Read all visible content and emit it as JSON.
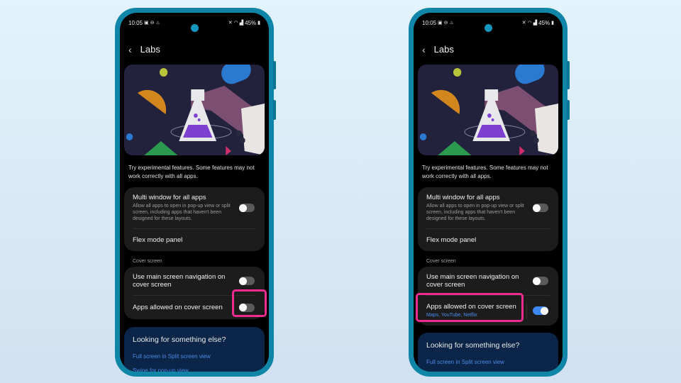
{
  "colors": {
    "frame": "#0f86a8",
    "highlight": "#ee2c8f",
    "toggle_on": "#3e88f6",
    "link": "#4b8ae8"
  },
  "phones": [
    {
      "status": {
        "time": "10:05",
        "left_icons": [
          "gallery-icon",
          "dnd-icon",
          "notification-icon"
        ],
        "right_icons": [
          "mute-icon",
          "wifi-icon",
          "signal-icon"
        ],
        "battery": "45%"
      },
      "header": {
        "back": "‹",
        "title": "Labs"
      },
      "description": "Try experimental features. Some features may not work correctly with all apps.",
      "settings_card": {
        "items": [
          {
            "label": "Multi window for all apps",
            "sub": "Allow all apps to open in pop-up view or split screen, including apps that haven't been designed for these layouts.",
            "toggle": false
          },
          {
            "label": "Flex mode panel"
          }
        ]
      },
      "cover_section": {
        "label": "Cover screen",
        "items": [
          {
            "label": "Use main screen navigation on cover screen",
            "toggle": false
          },
          {
            "label": "Apps allowed on cover screen",
            "toggle": false,
            "highlighted": "toggle"
          }
        ]
      },
      "looking": {
        "title": "Looking for something else?",
        "links": [
          "Full screen in Split screen view",
          "Swipe for pop-up view"
        ]
      }
    },
    {
      "status": {
        "time": "10:05",
        "left_icons": [
          "gallery-icon",
          "dnd-icon",
          "notification-icon"
        ],
        "right_icons": [
          "mute-icon",
          "wifi-icon",
          "signal-icon"
        ],
        "battery": "45%"
      },
      "header": {
        "back": "‹",
        "title": "Labs"
      },
      "description": "Try experimental features. Some features may not work correctly with all apps.",
      "settings_card": {
        "items": [
          {
            "label": "Multi window for all apps",
            "sub": "Allow all apps to open in pop-up view or split screen, including apps that haven't been designed for these layouts.",
            "toggle": false
          },
          {
            "label": "Flex mode panel"
          }
        ]
      },
      "cover_section": {
        "label": "Cover screen",
        "items": [
          {
            "label": "Use main screen navigation on cover screen",
            "toggle": false
          },
          {
            "label": "Apps allowed on cover screen",
            "sub": "Maps, YouTube, Netflix",
            "toggle": true,
            "highlighted": "label"
          }
        ]
      },
      "looking": {
        "title": "Looking for something else?",
        "links": [
          "Full screen in Split screen view"
        ]
      }
    }
  ]
}
